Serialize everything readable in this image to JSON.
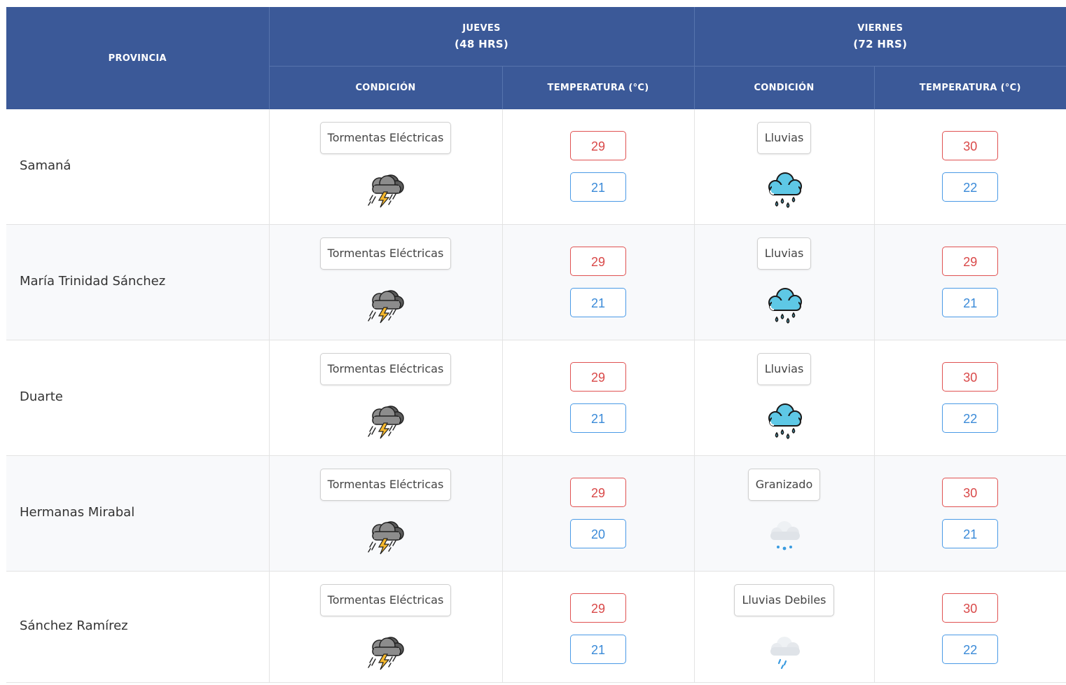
{
  "colors": {
    "header_bg": "#3b5998",
    "header_text": "#ffffff",
    "max_temp": "#d94848",
    "min_temp": "#3a8ad8"
  },
  "header": {
    "province": "PROVINCIA",
    "day1": {
      "name": "JUEVES",
      "hours": "(48 HRS)"
    },
    "day2": {
      "name": "VIERNES",
      "hours": "(72 HRS)"
    },
    "condition": "CONDICIÓN",
    "temperature": "TEMPERATURA (°C)"
  },
  "rows": [
    {
      "province": "Samaná",
      "day1": {
        "condition": "Tormentas Eléctricas",
        "icon": "thunderstorm-icon",
        "max": "29",
        "min": "21"
      },
      "day2": {
        "condition": "Lluvias",
        "icon": "rain-icon",
        "max": "30",
        "min": "22"
      }
    },
    {
      "province": "María Trinidad Sánchez",
      "day1": {
        "condition": "Tormentas Eléctricas",
        "icon": "thunderstorm-icon",
        "max": "29",
        "min": "21"
      },
      "day2": {
        "condition": "Lluvias",
        "icon": "rain-icon",
        "max": "29",
        "min": "21"
      }
    },
    {
      "province": "Duarte",
      "day1": {
        "condition": "Tormentas Eléctricas",
        "icon": "thunderstorm-icon",
        "max": "29",
        "min": "21"
      },
      "day2": {
        "condition": "Lluvias",
        "icon": "rain-icon",
        "max": "30",
        "min": "22"
      }
    },
    {
      "province": "Hermanas Mirabal",
      "day1": {
        "condition": "Tormentas Eléctricas",
        "icon": "thunderstorm-icon",
        "max": "29",
        "min": "20"
      },
      "day2": {
        "condition": "Granizado",
        "icon": "hail-icon",
        "max": "30",
        "min": "21"
      }
    },
    {
      "province": "Sánchez Ramírez",
      "day1": {
        "condition": "Tormentas Eléctricas",
        "icon": "thunderstorm-icon",
        "max": "29",
        "min": "21"
      },
      "day2": {
        "condition": "Lluvias Debiles",
        "icon": "light-rain-icon",
        "max": "30",
        "min": "22"
      }
    }
  ]
}
